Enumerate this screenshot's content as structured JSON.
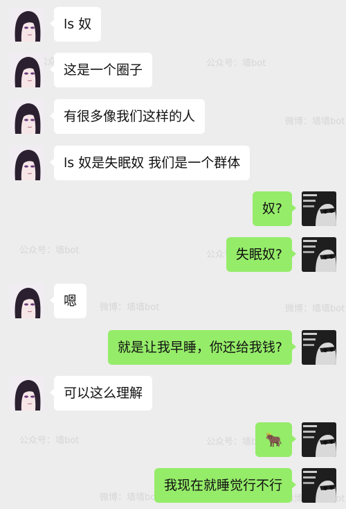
{
  "watermarks": {
    "gzh": "公众号：墙bot",
    "weibo": "微博：墙墙bot"
  },
  "messages": [
    {
      "side": "left",
      "text": "ls 奴"
    },
    {
      "side": "left",
      "text": "这是一个圈子"
    },
    {
      "side": "left",
      "text": "有很多像我们这样的人"
    },
    {
      "side": "left",
      "text": "ls 奴是失眠奴 我们是一个群体"
    },
    {
      "side": "right",
      "text": "奴?"
    },
    {
      "side": "right",
      "text": "失眠奴?"
    },
    {
      "side": "left",
      "text": "嗯"
    },
    {
      "side": "right",
      "text": "就是让我早睡，你还给我钱?"
    },
    {
      "side": "left",
      "text": "可以这么理解"
    },
    {
      "side": "right",
      "text": "🐂",
      "icon": "ox-emoji"
    },
    {
      "side": "right",
      "text": "我现在就睡觉行不行"
    }
  ]
}
